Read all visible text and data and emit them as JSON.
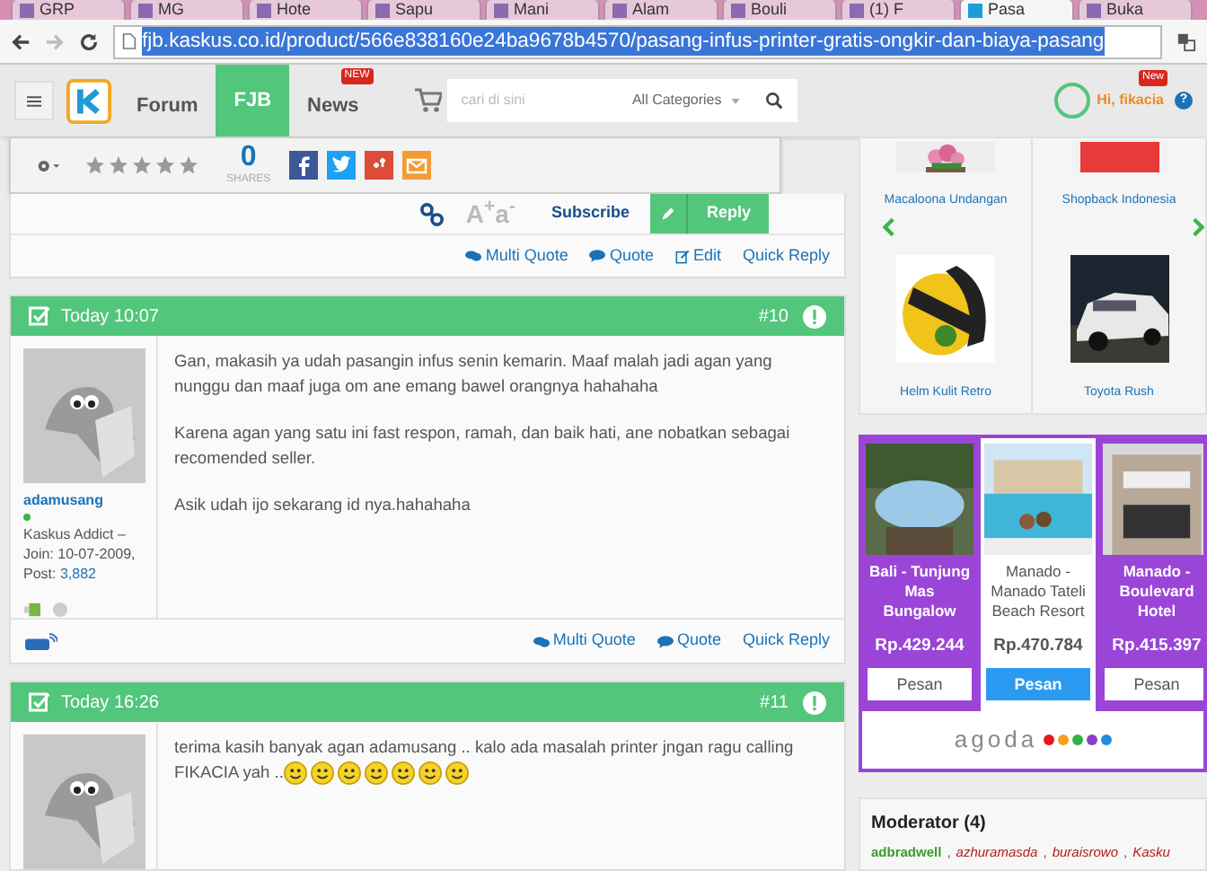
{
  "browser": {
    "tabs": [
      {
        "title": "GRP",
        "selected": false
      },
      {
        "title": "MG",
        "selected": false
      },
      {
        "title": "Hote",
        "selected": false
      },
      {
        "title": "Sapu",
        "selected": false
      },
      {
        "title": "Mani",
        "selected": false
      },
      {
        "title": "Alam",
        "selected": false
      },
      {
        "title": "Bouli",
        "selected": false
      },
      {
        "title": "(1) F",
        "selected": false
      },
      {
        "title": "Pasa",
        "selected": true
      },
      {
        "title": "Buka",
        "selected": false
      }
    ],
    "url": "fjb.kaskus.co.id/product/566e838160e24ba9678b4570/pasang-infus-printer-gratis-ongkir-dan-biaya-pasang"
  },
  "header": {
    "nav": [
      {
        "label": "Forum",
        "selected": false
      },
      {
        "label": "FJB",
        "selected": true
      },
      {
        "label": "News",
        "selected": false,
        "badge": "NEW"
      }
    ],
    "search": {
      "placeholder": "cari di sini",
      "category": "All Categories"
    },
    "user": {
      "greeting": "Hi, fikacia",
      "badge": "New",
      "help": "?"
    }
  },
  "share_bar": {
    "stars": 0,
    "share_count": "0",
    "share_label": "SHARES"
  },
  "prev_post": {
    "font_size": "A$^{+}$a$^{-}$",
    "subscribe": "Subscribe",
    "reply": "Reply",
    "actions": [
      "Multi Quote",
      "Quote",
      "Edit",
      "Quick Reply"
    ]
  },
  "posts": [
    {
      "time": "Today 10:07",
      "number": "#10",
      "user": {
        "name": "adamusang",
        "online": true,
        "rank": "Kaskus Addict –",
        "join": "Join: 10-07-2009,",
        "post_label": "Post:",
        "post_count": "3,882"
      },
      "paragraphs": [
        "Gan, makasih ya udah pasangin infus senin kemarin. Maaf malah jadi agan yang nunggu dan maaf juga om ane emang bawel orangnya hahahaha",
        "Karena agan yang satu ini fast respon, ramah, dan baik hati, ane nobatkan sebagai recomended seller.",
        "Asik udah ijo sekarang id nya.hahahaha"
      ],
      "actions": [
        "Multi Quote",
        "Quote",
        "Quick Reply"
      ]
    },
    {
      "time": "Today 16:26",
      "number": "#11",
      "paragraphs": [
        "terima kasih banyak agan adamusang .. kalo ada masalah printer jngan ragu calling FIKACIA yah .."
      ],
      "emoticons": [
        {
          "kind": "smile"
        },
        {
          "kind": "smile"
        },
        {
          "kind": "smile"
        },
        {
          "kind": "smile"
        },
        {
          "kind": "smile"
        },
        {
          "kind": "smile"
        },
        {
          "kind": "smile"
        }
      ]
    }
  ],
  "ads": [
    {
      "label": "Macaloona Undangan"
    },
    {
      "label": "Shopback Indonesia"
    },
    {
      "label": "Helm Kulit Retro"
    },
    {
      "label": "Toyota Rush"
    }
  ],
  "agoda": {
    "hotels": [
      {
        "name": "Bali - Tunjung Mas Bungalow",
        "price": "Rp.429.244",
        "button": "Pesan",
        "selected": false
      },
      {
        "name": "Manado - Manado Tateli Beach Resort",
        "price": "Rp.470.784",
        "button": "Pesan",
        "selected": true
      },
      {
        "name": "Manado - Boulevard Hotel",
        "price": "Rp.415.397",
        "button": "Pesan",
        "selected": false
      }
    ],
    "logo": "agoda",
    "dots": [
      {
        "color": "#e8141e"
      },
      {
        "color": "#f6a01a"
      },
      {
        "color": "#2db14a"
      },
      {
        "color": "#8a3fc4"
      },
      {
        "color": "#1f8ce0"
      }
    ]
  },
  "moderators": {
    "title": "Moderator (4)",
    "separator": ",",
    "names": [
      {
        "name": "adbradwell",
        "color": "#3a9b2a"
      },
      {
        "name": "azhuramasda",
        "color": "#b01c1c"
      },
      {
        "name": "buraisrowo",
        "color": "#b01c1c"
      },
      {
        "name": "Kasku",
        "color": "#b01c1c"
      }
    ]
  }
}
